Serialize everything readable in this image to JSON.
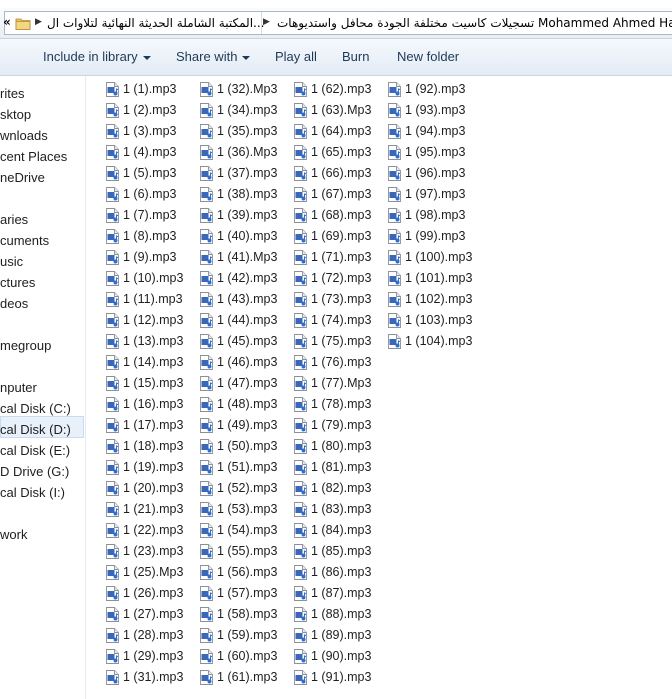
{
  "address_bar": {
    "crumbs": [
      "المكتبة الشاملة الحديثة النهائية لتلاوات ال...",
      "تسجيلات كاسيت مختلفة الجودة محافل واستديوهات Mohammed Ahmed Hamr"
    ],
    "left_arrow": "«"
  },
  "toolbar": {
    "include_in_library": "Include in library",
    "share_with": "Share with",
    "play_all": "Play all",
    "burn": "Burn",
    "new_folder": "New folder"
  },
  "nav": {
    "items": [
      "rites",
      "sktop",
      "wnloads",
      "cent Places",
      "neDrive",
      "",
      "aries",
      "cuments",
      "usic",
      "ctures",
      "deos",
      "",
      "megroup",
      "",
      "nputer",
      "cal Disk (C:)",
      "cal Disk (D:)",
      "cal Disk (E:)",
      "D Drive (G:)",
      "cal Disk (I:)",
      "",
      "work"
    ],
    "selected_index": 16
  },
  "files": {
    "columns": [
      [
        "1 (1).mp3",
        "1 (2).mp3",
        "1 (3).mp3",
        "1 (4).mp3",
        "1 (5).mp3",
        "1 (6).mp3",
        "1 (7).mp3",
        "1 (8).mp3",
        "1 (9).mp3",
        "1 (10).mp3",
        "1 (11).mp3",
        "1 (12).mp3",
        "1 (13).mp3",
        "1 (14).mp3",
        "1 (15).mp3",
        "1 (16).mp3",
        "1 (17).mp3",
        "1 (18).mp3",
        "1 (19).mp3",
        "1 (20).mp3",
        "1 (21).mp3",
        "1 (22).mp3",
        "1 (23).mp3",
        "1 (25).Mp3",
        "1 (26).mp3",
        "1 (27).mp3",
        "1 (28).mp3",
        "1 (29).mp3",
        "1 (31).mp3"
      ],
      [
        "1 (32).Mp3",
        "1 (34).mp3",
        "1 (35).mp3",
        "1 (36).Mp3",
        "1 (37).mp3",
        "1 (38).mp3",
        "1 (39).mp3",
        "1 (40).mp3",
        "1 (41).Mp3",
        "1 (42).mp3",
        "1 (43).mp3",
        "1 (44).mp3",
        "1 (45).mp3",
        "1 (46).mp3",
        "1 (47).mp3",
        "1 (48).mp3",
        "1 (49).mp3",
        "1 (50).mp3",
        "1 (51).mp3",
        "1 (52).mp3",
        "1 (53).mp3",
        "1 (54).mp3",
        "1 (55).mp3",
        "1 (56).mp3",
        "1 (57).mp3",
        "1 (58).mp3",
        "1 (59).mp3",
        "1 (60).mp3",
        "1 (61).mp3"
      ],
      [
        "1 (62).mp3",
        "1 (63).Mp3",
        "1 (64).mp3",
        "1 (65).mp3",
        "1 (66).mp3",
        "1 (67).mp3",
        "1 (68).mp3",
        "1 (69).mp3",
        "1 (71).mp3",
        "1 (72).mp3",
        "1 (73).mp3",
        "1 (74).mp3",
        "1 (75).mp3",
        "1 (76).mp3",
        "1 (77).Mp3",
        "1 (78).mp3",
        "1 (79).mp3",
        "1 (80).mp3",
        "1 (81).mp3",
        "1 (82).mp3",
        "1 (83).mp3",
        "1 (84).mp3",
        "1 (85).mp3",
        "1 (86).mp3",
        "1 (87).mp3",
        "1 (88).mp3",
        "1 (89).mp3",
        "1 (90).mp3",
        "1 (91).mp3"
      ],
      [
        "1 (92).mp3",
        "1 (93).mp3",
        "1 (94).mp3",
        "1 (95).mp3",
        "1 (96).mp3",
        "1 (97).mp3",
        "1 (98).mp3",
        "1 (99).mp3",
        "1 (100).mp3",
        "1 (101).mp3",
        "1 (102).mp3",
        "1 (103).mp3",
        "1 (104).mp3"
      ]
    ],
    "icon": "audio-file-icon"
  }
}
